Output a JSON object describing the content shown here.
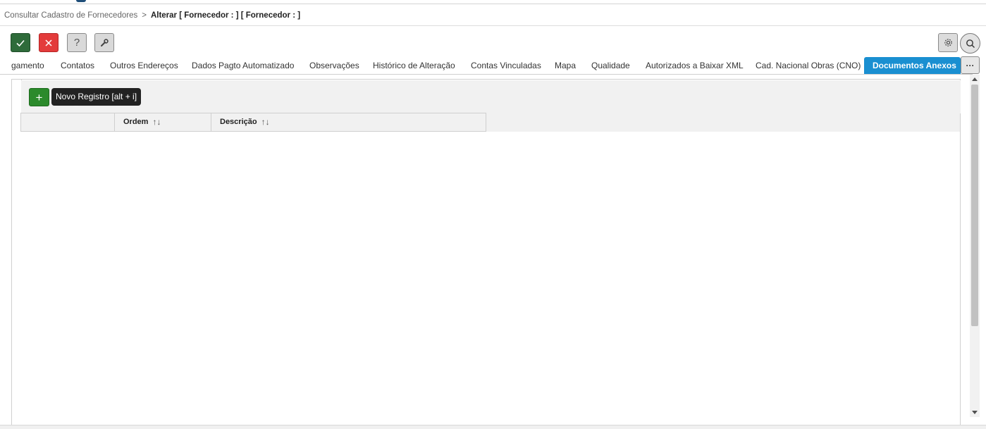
{
  "breadcrumb": {
    "parent": "Consultar Cadastro de Fornecedores",
    "separator": ">",
    "current": "Alterar [ Fornecedor : ] [ Fornecedor : ]"
  },
  "toolbar": {
    "confirm_icon": "check-icon",
    "cancel_icon": "close-icon",
    "help_label": "?",
    "tools_icon": "wrench-icon",
    "settings_icon": "gear-icon",
    "search_icon": "search-icon"
  },
  "tabs": [
    {
      "label": "gamento"
    },
    {
      "label": "Contatos"
    },
    {
      "label": "Outros Endereços"
    },
    {
      "label": "Dados Pagto Automatizado"
    },
    {
      "label": "Observações"
    },
    {
      "label": "Histórico de Alteração"
    },
    {
      "label": "Contas Vinculadas"
    },
    {
      "label": "Mapa"
    },
    {
      "label": "Qualidade"
    },
    {
      "label": "Autorizados a Baixar XML"
    },
    {
      "label": "Cad. Nacional Obras (CNO)"
    },
    {
      "label": "Documentos Anexos",
      "active": true
    }
  ],
  "tabs_more_label": "···",
  "grid": {
    "add_label": "+",
    "tooltip": "Novo Registro [alt + i]",
    "columns": [
      {
        "label": ""
      },
      {
        "label": "Ordem"
      },
      {
        "label": "Descrição"
      }
    ],
    "sort_glyph": "↑↓"
  },
  "colors": {
    "active_tab": "#1a8fd1",
    "confirm": "#2e6b3a",
    "cancel": "#e33b3b",
    "add": "#2b8a2b"
  }
}
